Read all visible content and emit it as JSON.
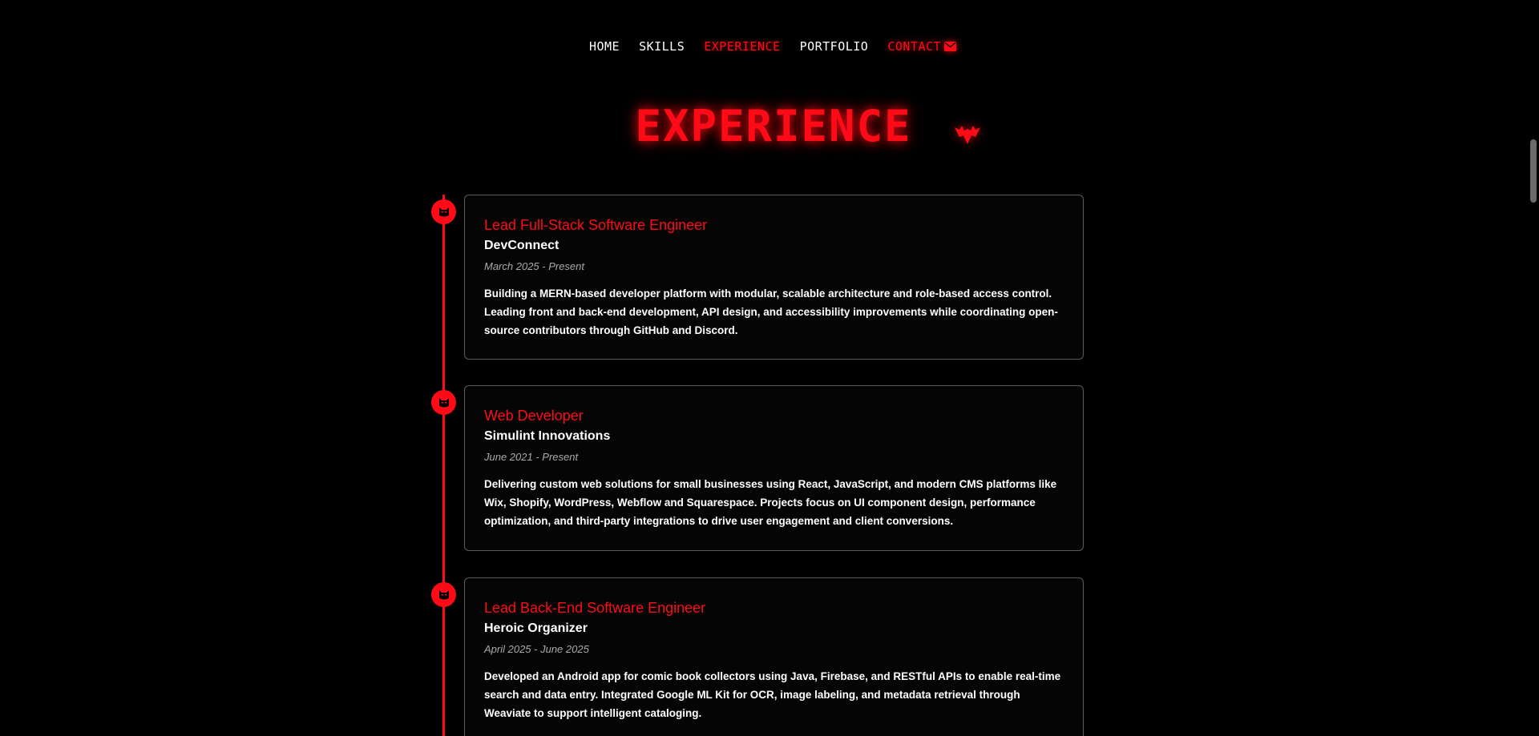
{
  "nav": {
    "items": [
      {
        "label": "HOME"
      },
      {
        "label": "SKILLS"
      },
      {
        "label": "EXPERIENCE"
      },
      {
        "label": "PORTFOLIO"
      },
      {
        "label": "CONTACT"
      }
    ],
    "active": "EXPERIENCE",
    "contact_icon": "envelope-icon"
  },
  "section": {
    "heading": "EXPERIENCE",
    "logo_icon": "bat-logo-icon"
  },
  "colors": {
    "accent": "#ff0a16",
    "background": "#000000",
    "card_border": "#5a5a5a",
    "muted_text": "#aaaaaa"
  },
  "timeline": {
    "dot_icon": "bat-mask-icon",
    "items": [
      {
        "title": "Lead Full-Stack Software Engineer",
        "company": "DevConnect",
        "dates": "March 2025 - Present",
        "description": "Building a MERN-based developer platform with modular, scalable architecture and role-based access control. Leading front and back-end development, API design, and accessibility improvements while coordinating open-source contributors through GitHub and Discord."
      },
      {
        "title": "Web Developer",
        "company": "Simulint Innovations",
        "dates": "June 2021 - Present",
        "description": "Delivering custom web solutions for small businesses using React, JavaScript, and modern CMS platforms like Wix, Shopify, WordPress, Webflow and Squarespace. Projects focus on UI component design, performance optimization, and third-party integrations to drive user engagement and client conversions."
      },
      {
        "title": "Lead Back-End Software Engineer",
        "company": "Heroic Organizer",
        "dates": "April 2025 - June 2025",
        "description": "Developed an Android app for comic book collectors using Java, Firebase, and RESTful APIs to enable real-time search and data entry. Integrated Google ML Kit for OCR, image labeling, and metadata retrieval through Weaviate to support intelligent cataloging."
      }
    ]
  }
}
